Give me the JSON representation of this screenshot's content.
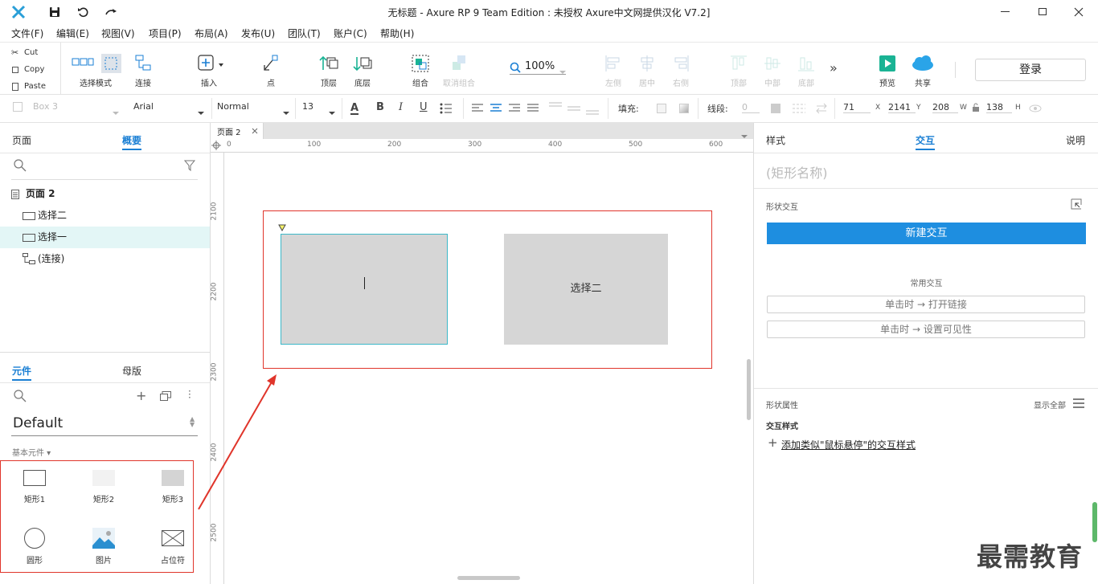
{
  "window": {
    "title": "无标题 - Axure RP 9 Team Edition : 未授权     Axure中文网提供汉化 V7.2]"
  },
  "menu": [
    "文件(F)",
    "编辑(E)",
    "视图(V)",
    "项目(P)",
    "布局(A)",
    "发布(U)",
    "团队(T)",
    "账户(C)",
    "帮助(H)"
  ],
  "clipboard": {
    "cut": "Cut",
    "copy": "Copy",
    "paste": "Paste"
  },
  "toolbar": {
    "select_mode": "选择模式",
    "connect": "连接",
    "insert": "插入",
    "point": "点",
    "front": "顶层",
    "back": "底层",
    "group": "组合",
    "ungroup": "取消组合",
    "zoom": "100%",
    "align_left": "左侧",
    "align_center": "居中",
    "align_right": "右侧",
    "align_top": "顶部",
    "align_middle": "中部",
    "align_bottom": "底部",
    "preview": "预览",
    "share": "共享",
    "login": "登录"
  },
  "format": {
    "style_select": "Box 3",
    "font": "Arial",
    "weight": "Normal",
    "size": "13",
    "fill_label": "填充:",
    "line_label": "线段:",
    "line_value": "0",
    "x": "71",
    "x_label": "X",
    "y": "2141",
    "y_label": "Y",
    "w": "208",
    "w_label": "W",
    "h": "138",
    "h_label": "H"
  },
  "left": {
    "tab_pages": "页面",
    "tab_outline": "概要",
    "tree": {
      "page": "页面 2",
      "item1": "选择二",
      "item2": "选择一",
      "item3": "(连接)"
    },
    "tab_widgets": "元件",
    "tab_masters": "母版",
    "library": "Default",
    "category": "基本元件 ▾",
    "widgets": [
      "矩形1",
      "矩形2",
      "矩形3",
      "圆形",
      "图片",
      "占位符"
    ]
  },
  "canvas": {
    "tab": "页面 2",
    "ruler_top": [
      "0",
      "100",
      "200",
      "300",
      "400",
      "500",
      "600"
    ],
    "ruler_left": [
      "2100",
      "2200",
      "2300",
      "2400",
      "2500"
    ],
    "shape2_label": "选择二"
  },
  "right": {
    "tab_style": "样式",
    "tab_interact": "交互",
    "tab_notes": "说明",
    "shape_name_placeholder": "(矩形名称)",
    "shape_interactions": "形状交互",
    "new_interaction": "新建交互",
    "common": "常用交互",
    "common_1": "单击时 → 打开链接",
    "common_2": "单击时 → 设置可见性",
    "shape_props": "形状属性",
    "show_all": "显示全部",
    "interaction_style": "交互样式",
    "add_style": "添加类似\"鼠标悬停\"的交互样式"
  },
  "watermark": "最需教育",
  "colors": {
    "accent": "#1a7fd4",
    "new_btn": "#1e8ee0",
    "selection": "#e0352b",
    "teal": "#3cb8c8"
  }
}
